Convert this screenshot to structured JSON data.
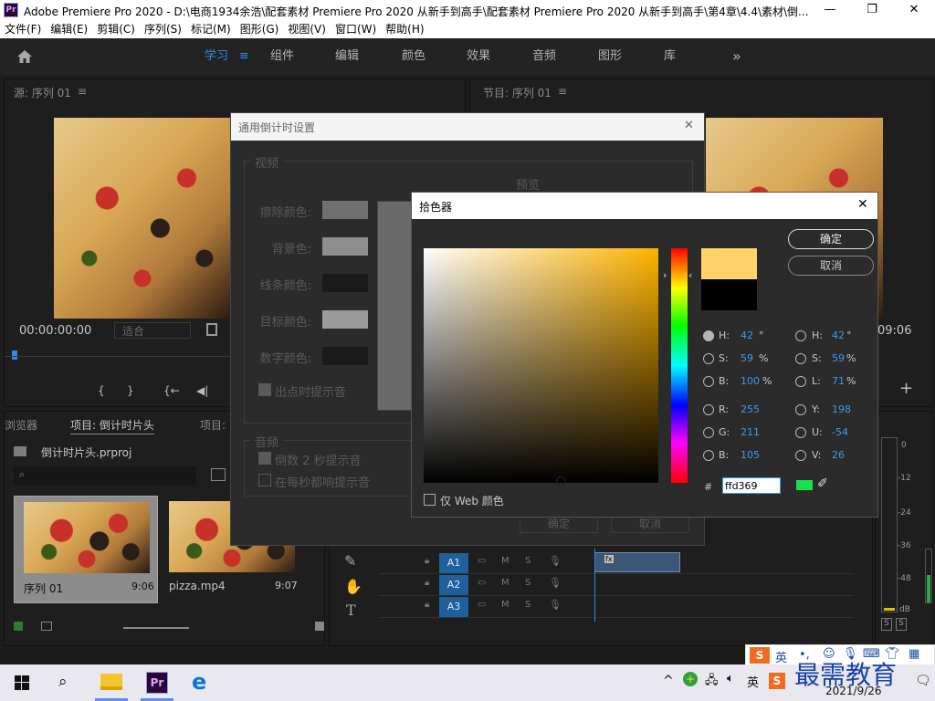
{
  "window": {
    "title": "Adobe Premiere Pro 2020 - D:\\电商1934余浩\\配套素材 Premiere Pro 2020 从新手到高手\\配套素材 Premiere Pro 2020 从新手到高手\\第4章\\4.4\\素材\\倒...",
    "app_icon_label": "Pr",
    "minimize": "—",
    "restore": "❐",
    "close": "✕"
  },
  "menu": [
    "文件(F)",
    "编辑(E)",
    "剪辑(C)",
    "序列(S)",
    "标记(M)",
    "图形(G)",
    "视图(V)",
    "窗口(W)",
    "帮助(H)"
  ],
  "workspaces": {
    "home_icon": "home-icon",
    "tabs": [
      "学习",
      "组件",
      "编辑",
      "颜色",
      "效果",
      "音频",
      "图形",
      "库"
    ],
    "active": "学习",
    "menu_glyph": "≡",
    "more": "»"
  },
  "source": {
    "title": "源: 序列 01",
    "menu": "≡",
    "timecode": "00:00:00:00",
    "fit": "适合",
    "controls": [
      "{",
      "}",
      "{←",
      "◀|"
    ]
  },
  "program": {
    "title": "节目: 序列 01",
    "menu": "≡",
    "timecode_end": "09:06"
  },
  "project": {
    "tab_left": "浏览器",
    "tab_active": "项目: 倒计时片头",
    "tab_right": "项目:",
    "file": "倒计时片头.prproj",
    "items": [
      {
        "name": "序列 01",
        "duration": "9:06"
      },
      {
        "name": "pizza.mp4",
        "duration": "9:07"
      }
    ]
  },
  "timeline": {
    "tracks": [
      {
        "label": "A1",
        "m": "M",
        "s": "S"
      },
      {
        "label": "A2",
        "m": "M",
        "s": "S"
      },
      {
        "label": "A3",
        "m": "M",
        "s": "S"
      }
    ],
    "tools": [
      "pen-icon",
      "hand-icon",
      "type-icon"
    ],
    "clip_badge": "fx"
  },
  "meter": {
    "scale": [
      "0",
      "-12",
      "-24",
      "-36",
      "-48",
      "dB"
    ],
    "solo": [
      "S",
      "S"
    ]
  },
  "countdown": {
    "title": "通用倒计时设置",
    "close": "✕",
    "video_group": "视频",
    "preview": "预览",
    "rows": [
      {
        "label": "擦除颜色:",
        "color": "#707070"
      },
      {
        "label": "背景色:",
        "color": "#8e8e8e"
      },
      {
        "label": "线条颜色:",
        "color": "#1a1a1a"
      },
      {
        "label": "目标颜色:",
        "color": "#9a9a9a"
      },
      {
        "label": "数字颜色:",
        "color": "#1a1a1a"
      }
    ],
    "cue_out": "出点时提示音",
    "audio_group": "音频",
    "cue_2s": "倒数 2 秒提示音",
    "cue_every": "在每秒都响提示音",
    "ok": "确定",
    "cancel": "取消"
  },
  "picker": {
    "title": "拾色器",
    "close": "✕",
    "ok": "确定",
    "cancel": "取消",
    "new_color": "#ffd369",
    "old_color": "#000000",
    "hsb": [
      {
        "label": "H:",
        "value": "42",
        "unit": "°",
        "on": true
      },
      {
        "label": "S:",
        "value": "59",
        "unit": "%",
        "on": false
      },
      {
        "label": "B:",
        "value": "100",
        "unit": "%",
        "on": false
      }
    ],
    "hsl": [
      {
        "label": "H:",
        "value": "42",
        "unit": "°"
      },
      {
        "label": "S:",
        "value": "59",
        "unit": "%"
      },
      {
        "label": "L:",
        "value": "71",
        "unit": "%"
      }
    ],
    "rgb": [
      {
        "label": "R:",
        "value": "255"
      },
      {
        "label": "G:",
        "value": "211"
      },
      {
        "label": "B:",
        "value": "105"
      }
    ],
    "yuv": [
      {
        "label": "Y:",
        "value": "198"
      },
      {
        "label": "U:",
        "value": "-54"
      },
      {
        "label": "V:",
        "value": "26"
      }
    ],
    "hash": "#",
    "hex": "ffd369",
    "web_only": "仅 Web 颜色",
    "gamut_swatch": "#15e34a"
  },
  "taskbar": {
    "clock_date": "2021/9/26",
    "ime_lang": "英",
    "watermark": "最需教育",
    "tray_lang": "英"
  }
}
